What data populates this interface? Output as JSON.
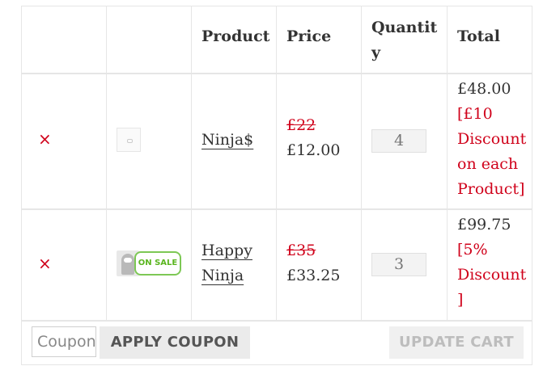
{
  "header": {
    "product": "Product",
    "price": "Price",
    "quantity": "Quantity",
    "total": "Total"
  },
  "items": [
    {
      "remove": "×",
      "name": "Ninja$",
      "regular_price": "£22",
      "sale_price": "£12.00",
      "quantity": "4",
      "total": "£48.00",
      "discount_note": "[£10 Discount on each Product]"
    },
    {
      "remove": "×",
      "badge": "ON SALE",
      "name": "Happy Ninja",
      "regular_price": "£35",
      "sale_price": "£33.25",
      "quantity": "3",
      "total": "£99.75",
      "discount_note": "[5% Discount ]"
    }
  ],
  "coupon": {
    "placeholder": "Coupon code",
    "apply_label": "APPLY COUPON"
  },
  "update_label": "UPDATE CART",
  "colors": {
    "discount_red": "#d0021b",
    "sale_badge_green": "#5ab51f",
    "border": "#e6e6e6"
  }
}
